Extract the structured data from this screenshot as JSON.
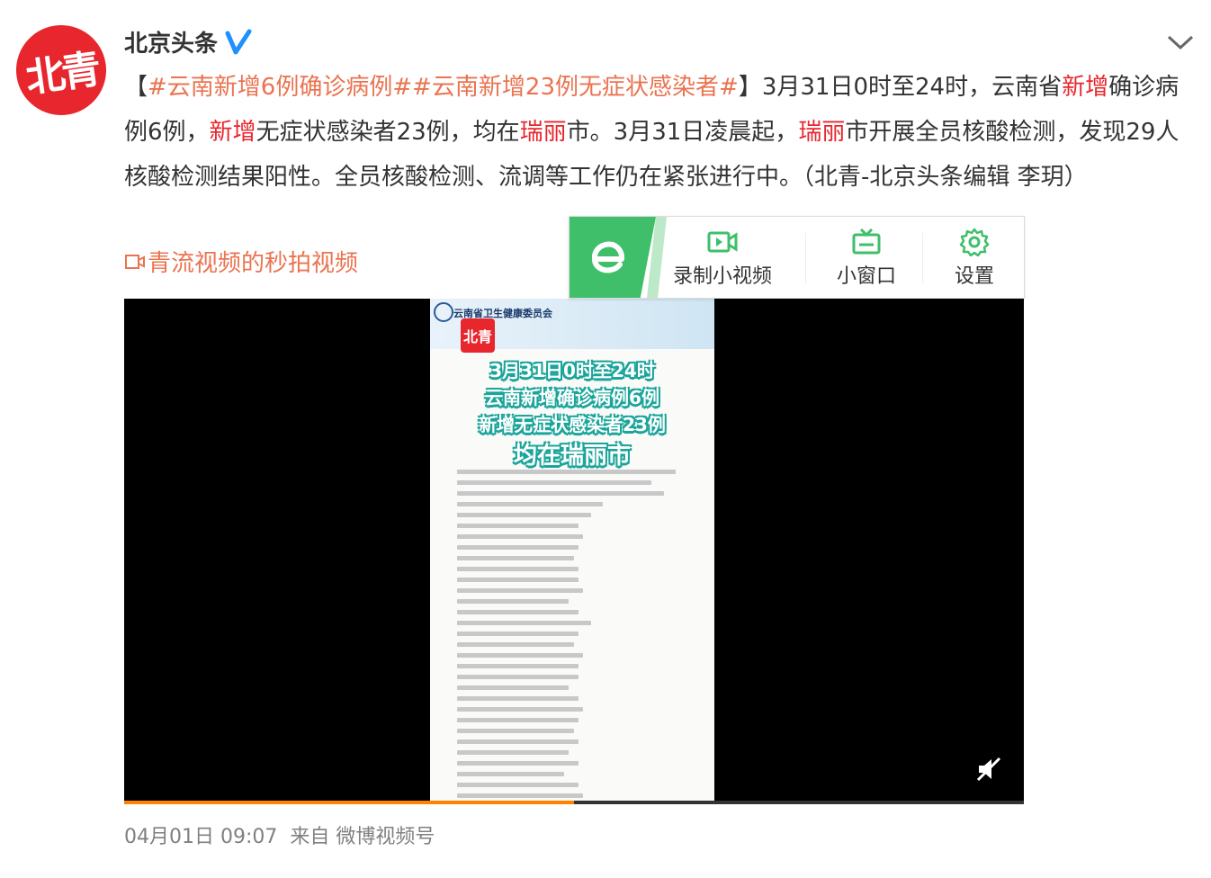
{
  "user": {
    "avatar_text": "北青",
    "name": "北京头条"
  },
  "post": {
    "hashtag1": "#云南新增6例确诊病例#",
    "hashtag2": "#云南新增23例无症状感染者#",
    "bracket_open": "【",
    "bracket_close": "】",
    "seg1": "3月31日0时至24时，云南省",
    "hl1": "新增",
    "seg2": "确诊病例6例，",
    "hl2": "新增",
    "seg3": "无症状感染者23例，均在",
    "hl3": "瑞丽",
    "seg4": "市。3月31日凌晨起，",
    "hl4": "瑞丽",
    "seg5": "市开展全员核酸检测，发现29人核酸检测结果阳性。全员核酸检测、流调等工作仍在紧张进行中。（北青-北京头条编辑 李玥）"
  },
  "video_link": {
    "label": "青流视频的秒拍视频"
  },
  "video": {
    "header_org": "云南省卫生健康委员会",
    "logo_text": "北青",
    "overlay": [
      "3月31日0时至24时",
      "云南新增确诊病例6例",
      "新增无症状感染者23例",
      "均在瑞丽市"
    ],
    "progress": 0.5
  },
  "toolbar": {
    "record_label": "录制小视频",
    "mini_label": "小窗口",
    "settings_label": "设置"
  },
  "meta": {
    "time": "04月01日 09:07",
    "source_prefix": "来自",
    "source": "微博视频号"
  },
  "colors": {
    "hashtag": "#eb7350",
    "highlight": "#e8262d",
    "toolbar_green": "#3fbf6a",
    "overlay_teal": "#1aa59a",
    "verified_blue": "#1e90ff"
  }
}
